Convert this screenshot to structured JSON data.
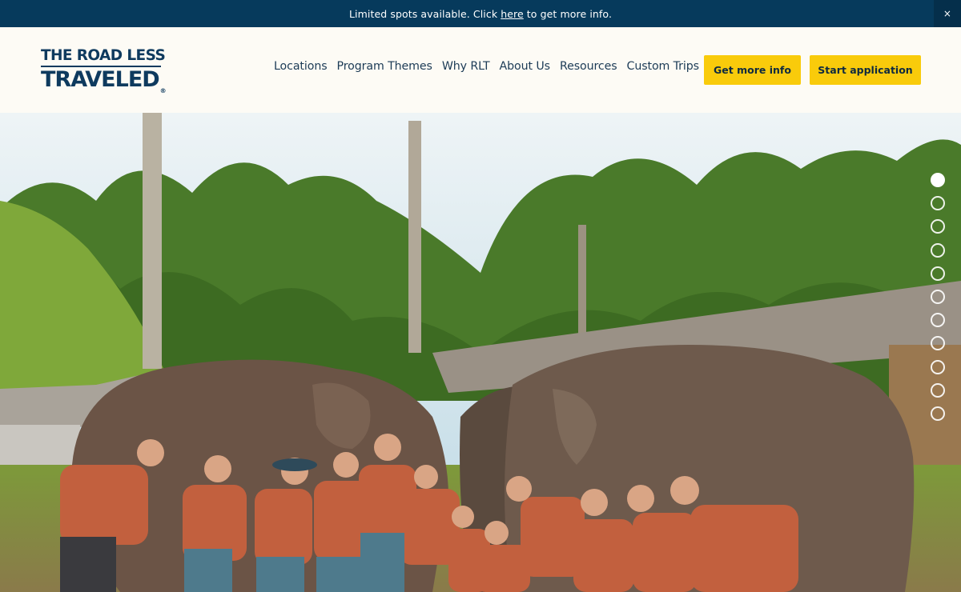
{
  "announcement": {
    "before": "Limited spots available. Click",
    "link": "here",
    "after": "to get more info.",
    "close_glyph": "×"
  },
  "logo": {
    "line1": "THE ROAD LESS",
    "line2": "TRAVELED",
    "mark": "®"
  },
  "nav": {
    "items": [
      "Locations",
      "Program Themes",
      "Why RLT",
      "About Us",
      "Resources",
      "Custom Trips"
    ]
  },
  "buttons": {
    "get_info": "Get more info",
    "start_application": "Start application"
  },
  "hero": {
    "image_description": "Students in orange scrubs posing with elephants in a jungle sanctuary",
    "slide_count": 11,
    "active_slide": 1
  },
  "colors": {
    "announcement_bg": "#063a5c",
    "brand_navy": "#0e3a5e",
    "cta_yellow": "#f9cb0b",
    "header_bg": "#fdfbf5"
  }
}
